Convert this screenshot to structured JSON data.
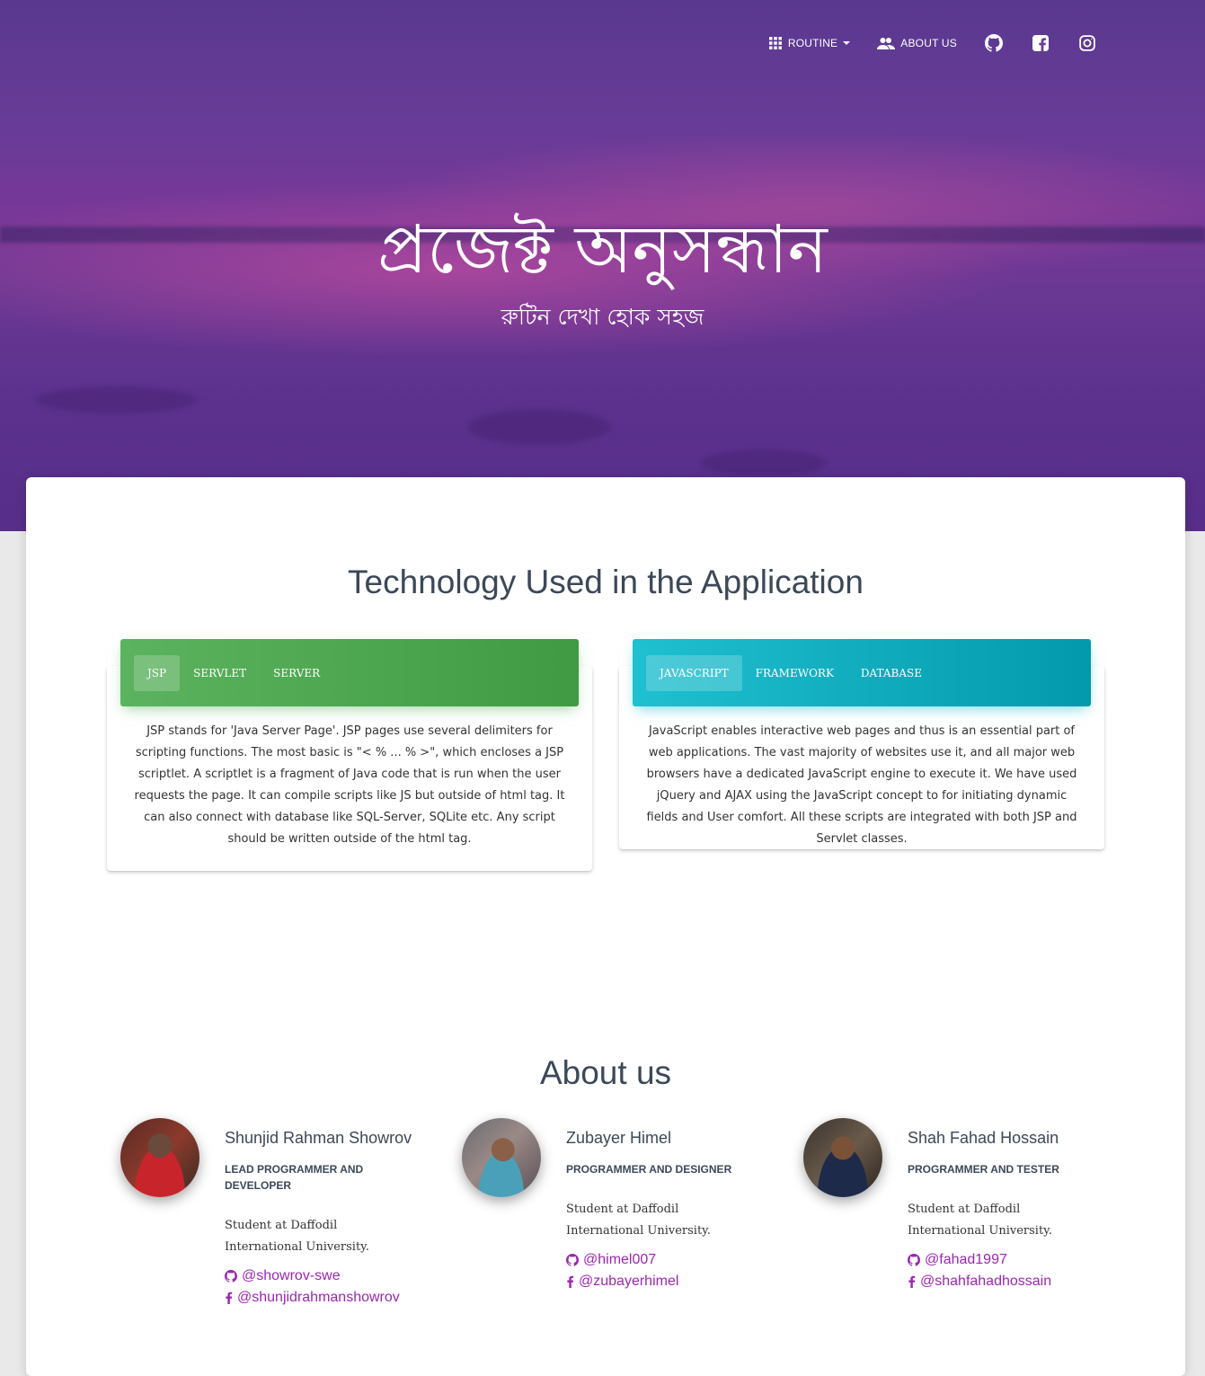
{
  "nav": {
    "routine_label": "ROUTINE",
    "about_label": "ABOUT US",
    "icons": [
      "apps-icon",
      "people-icon",
      "github-icon",
      "facebook-icon",
      "instagram-icon"
    ]
  },
  "hero": {
    "title": "প্রজেক্ট অনুসন্ধান",
    "subtitle": "রুটিন দেখা হোক সহজ"
  },
  "technology": {
    "heading": "Technology Used in the Application",
    "left_card": {
      "tabs": [
        "JSP",
        "SERVLET",
        "SERVER"
      ],
      "active_tab": "JSP",
      "body": "JSP stands for 'Java Server Page'. JSP pages use several delimiters for scripting functions. The most basic is \"< % ... % >\", which encloses a JSP scriptlet. A scriptlet is a fragment of Java code that is run when the user requests the page. It can compile scripts like JS but outside of html tag. It can also connect with database like SQL-Server, SQLite etc. Any script should be written outside of the html tag."
    },
    "right_card": {
      "tabs": [
        "JAVASCRIPT",
        "FRAMEWORK",
        "DATABASE"
      ],
      "active_tab": "JAVASCRIPT",
      "body": "JavaScript enables interactive web pages and thus is an essential part of web applications. The vast majority of websites use it, and all major web browsers have a dedicated JavaScript engine to execute it. We have used jQuery and AJAX using the JavaScript concept to for initiating dynamic fields and User comfort. All these scripts are integrated with both JSP and Servlet classes."
    }
  },
  "about": {
    "heading": "About us",
    "members": [
      {
        "name": "Shunjid Rahman Showrov",
        "role": "LEAD PROGRAMMER AND DEVELOPER",
        "description": "Student at Daffodil International University.",
        "github": "@showrov-swe",
        "facebook": "@shunjidrahmanshowrov"
      },
      {
        "name": "Zubayer Himel",
        "role": "PROGRAMMER AND DESIGNER",
        "description": "Student at Daffodil International University.",
        "github": "@himel007",
        "facebook": "@zubayerhimel"
      },
      {
        "name": "Shah Fahad Hossain",
        "role": "PROGRAMMER AND TESTER",
        "description": "Student at Daffodil International University.",
        "github": "@fahad1997",
        "facebook": "@shahfahadhossain"
      }
    ]
  },
  "colors": {
    "hero": "#6a3d9a",
    "green_tab": "#4caf50",
    "cyan_tab": "#00acc1",
    "link": "#9c27b0",
    "heading": "#3c4858"
  }
}
